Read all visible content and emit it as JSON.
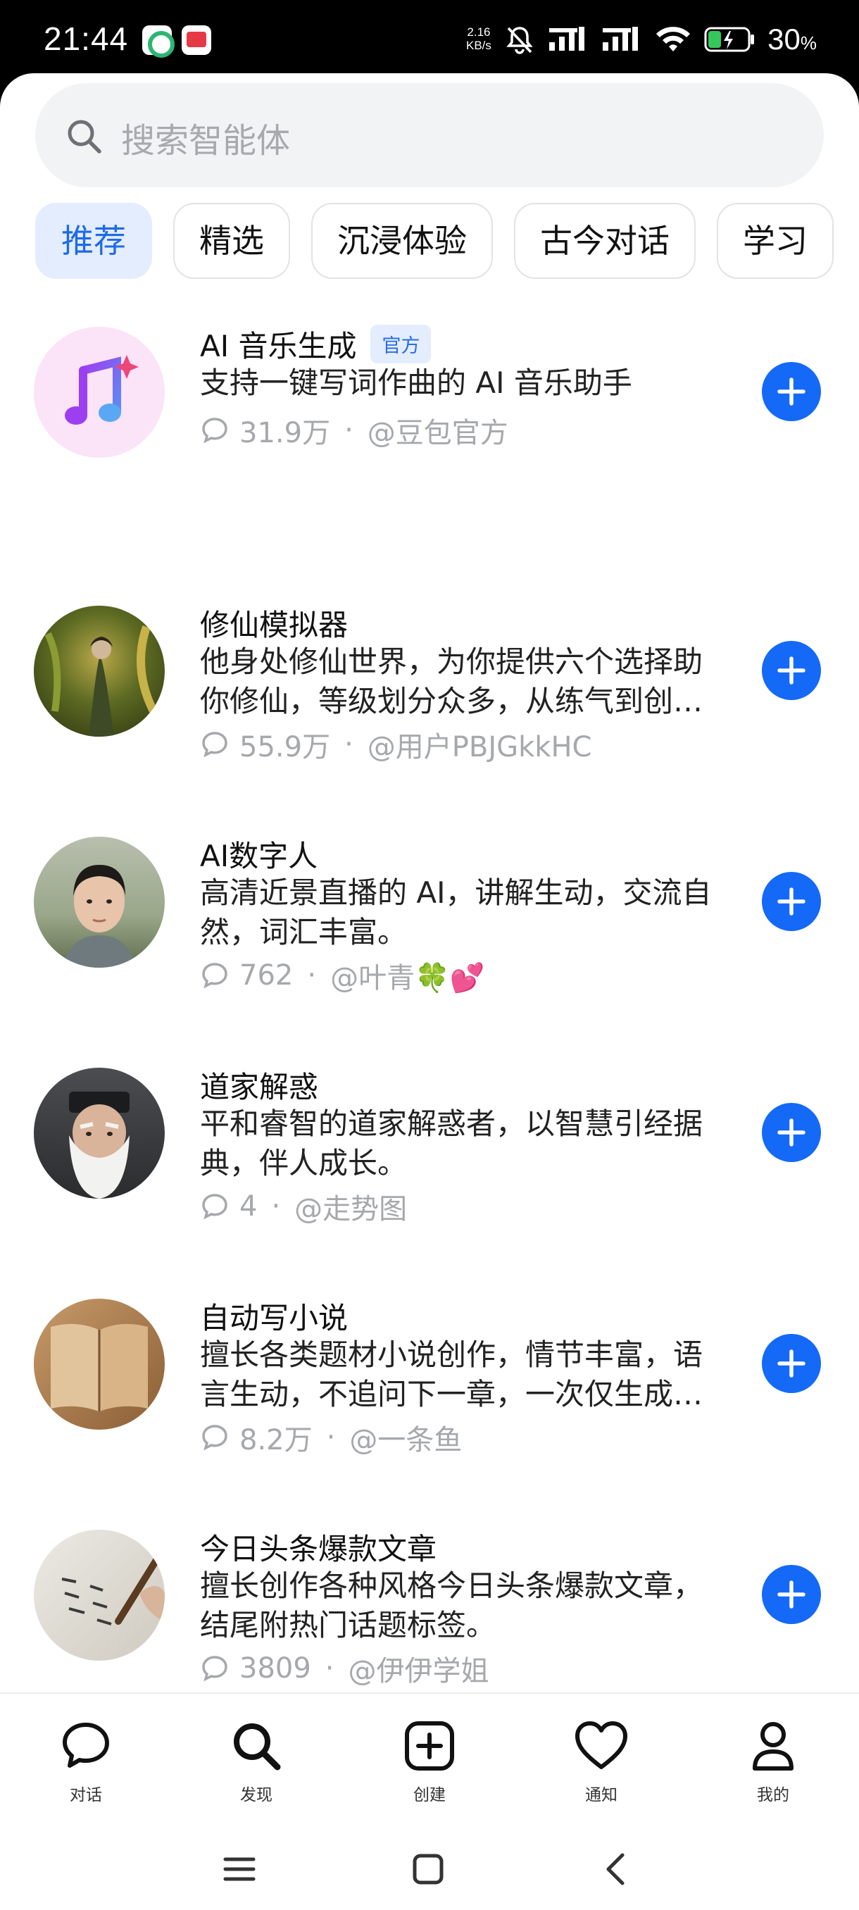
{
  "status_bar": {
    "time": "21:44",
    "net_speed_value": "2.16",
    "net_speed_unit": "KB/s",
    "battery_percent": "30",
    "battery_unit": "%",
    "icons": [
      "app-icon-1",
      "app-icon-2",
      "mute-icon",
      "signal-icon",
      "signal-icon",
      "wifi-icon",
      "battery-charging-icon"
    ]
  },
  "search": {
    "placeholder": "搜索智能体"
  },
  "tabs": [
    {
      "label": "推荐",
      "active": true
    },
    {
      "label": "精选",
      "active": false
    },
    {
      "label": "沉浸体验",
      "active": false
    },
    {
      "label": "古今对话",
      "active": false
    },
    {
      "label": "学习",
      "active": false
    }
  ],
  "agents": [
    {
      "title": "AI 音乐生成",
      "badge": "官方",
      "desc": "支持一键写词作曲的 AI 音乐助手",
      "count": "31.9万",
      "author": "@豆包官方",
      "avatar": "music-note-icon"
    },
    {
      "title": "修仙模拟器",
      "desc": "他身处修仙世界，为你提供六个选择助你修仙，等级划分众多，从练气到创世神。",
      "count": "55.9万",
      "author": "@用户PBJGkkHC",
      "avatar": "cultivator-avatar"
    },
    {
      "title": "AI数字人",
      "desc": "高清近景直播的 AI，讲解生动，交流自然，词汇丰富。",
      "count": "762",
      "author": "@叶青🍀💕",
      "avatar": "digital-human-avatar"
    },
    {
      "title": "道家解惑",
      "desc": "平和睿智的道家解惑者，以智慧引经据典，伴人成长。",
      "count": "4",
      "author": "@走势图",
      "avatar": "taoist-avatar"
    },
    {
      "title": "自动写小说",
      "desc": "擅长各类题材小说创作，情节丰富，语言生动，不追问下一章，一次仅生成一章。",
      "count": "8.2万",
      "author": "@一条鱼",
      "avatar": "book-avatar"
    },
    {
      "title": "今日头条爆款文章",
      "desc": "擅长创作各种风格今日头条爆款文章，结尾附热门话题标签。",
      "count": "3809",
      "author": "@伊伊学姐",
      "avatar": "calligraphy-avatar"
    }
  ],
  "bottom_nav": [
    {
      "label": "对话",
      "icon": "chat-bubble-icon"
    },
    {
      "label": "发现",
      "icon": "search-icon"
    },
    {
      "label": "创建",
      "icon": "add-square-icon"
    },
    {
      "label": "通知",
      "icon": "heart-icon"
    },
    {
      "label": "我的",
      "icon": "profile-icon"
    }
  ],
  "system_nav": [
    "menu-icon",
    "home-icon",
    "back-icon"
  ],
  "colors": {
    "accent": "#1469f7",
    "tab_active_bg": "#e3edfe",
    "muted_text": "#a6a8ac"
  }
}
